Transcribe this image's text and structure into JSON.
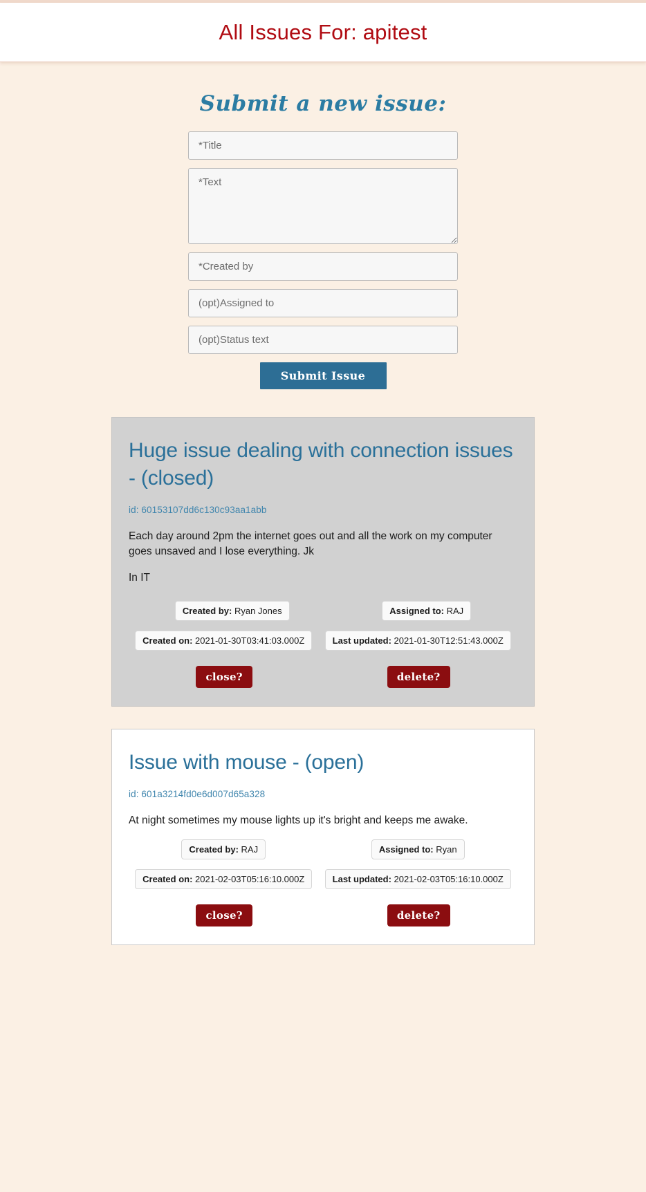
{
  "header": {
    "title": "All Issues For: apitest"
  },
  "form": {
    "heading": "Submit a new issue:",
    "fields": [
      {
        "name": "title",
        "placeholder": "*Title",
        "value": ""
      },
      {
        "name": "text",
        "placeholder": "*Text",
        "value": ""
      },
      {
        "name": "created_by",
        "placeholder": "*Created by",
        "value": ""
      },
      {
        "name": "assigned_to",
        "placeholder": "(opt)Assigned to",
        "value": ""
      },
      {
        "name": "status_text",
        "placeholder": "(opt)Status text",
        "value": ""
      }
    ],
    "submit_label": "Submit Issue"
  },
  "labels": {
    "id_prefix": "id: ",
    "created_by": "Created by:",
    "assigned_to": "Assigned to:",
    "created_on": "Created on:",
    "last_updated": "Last updated:",
    "close_label": "close?",
    "delete_label": "delete?"
  },
  "issues": [
    {
      "title": "Huge issue dealing with connection issues - (closed)",
      "id": "id: 60153107dd6c130c93aa1abb",
      "text": "Each day around 2pm the internet goes out and all the work on my computer goes unsaved and I lose everything. Jk",
      "status_text": "In IT",
      "created_by_label": "Created by:",
      "created_by": "Ryan Jones",
      "assigned_to_label": "Assigned to:",
      "assigned_to": "RAJ",
      "created_on_label": "Created on:",
      "created_on": "2021-01-30T03:41:03.000Z",
      "last_updated_label": "Last updated:",
      "last_updated": "2021-01-30T12:51:43.000Z",
      "close_label": "close?",
      "delete_label": "delete?",
      "state": "closed"
    },
    {
      "title": "Issue with mouse - (open)",
      "id": "id: 601a3214fd0e6d007d65a328",
      "text": "At night sometimes my mouse lights up it's bright and keeps me awake.",
      "status_text": "",
      "created_by_label": "Created by:",
      "created_by": "RAJ",
      "assigned_to_label": "Assigned to:",
      "assigned_to": "Ryan",
      "created_on_label": "Created on:",
      "created_on": "2021-02-03T05:16:10.000Z",
      "last_updated_label": "Last updated:",
      "last_updated": "2021-02-03T05:16:10.000Z",
      "close_label": "close?",
      "delete_label": "delete?",
      "state": "open"
    }
  ],
  "colors": {
    "header_title": "#b00b12",
    "accent_blue": "#2a7099",
    "submit_button": "#2d6e95",
    "danger_button": "#8b0d10",
    "background": "#fbf0e4",
    "closed_card": "#d1d1d1"
  }
}
